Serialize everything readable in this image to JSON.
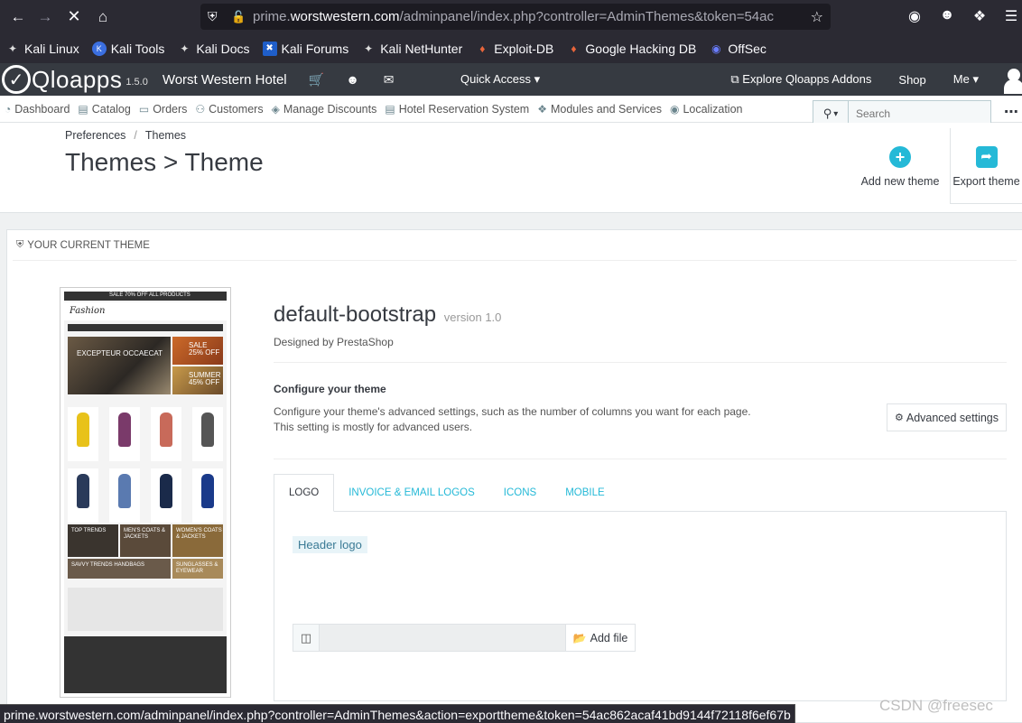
{
  "browser": {
    "url_prefix": "prime.",
    "url_domain": "worstwestern.com",
    "url_path": "/adminpanel/index.php?controller=AdminThemes&token=54ac",
    "bookmarks": [
      "Kali Linux",
      "Kali Tools",
      "Kali Docs",
      "Kali Forums",
      "Kali NetHunter",
      "Exploit-DB",
      "Google Hacking DB",
      "OffSec"
    ],
    "status_url": "prime.worstwestern.com/adminpanel/index.php?controller=AdminThemes&action=exporttheme&token=54ac862acaf41bd9144f72118f6ef67b"
  },
  "header": {
    "logo": "Qloapps",
    "version": "1.5.0",
    "shop_name": "Worst Western Hotel",
    "quick_access": "Quick Access",
    "explore": "Explore Qloapps Addons",
    "shop": "Shop",
    "me": "Me"
  },
  "menu": {
    "items": [
      "Dashboard",
      "Catalog",
      "Orders",
      "Customers",
      "Manage Discounts",
      "Hotel Reservation System",
      "Modules and Services",
      "Localization"
    ],
    "search_placeholder": "Search"
  },
  "page": {
    "breadcrumb_1": "Preferences",
    "breadcrumb_sep": "/",
    "breadcrumb_2": "Themes",
    "title": "Themes > Theme",
    "add_new_theme": "Add new theme",
    "export_theme": "Export theme"
  },
  "panel": {
    "heading": "YOUR CURRENT THEME",
    "theme_name": "default-bootstrap",
    "theme_version": "version 1.0",
    "designed_by": "Designed by PrestaShop",
    "configure_title": "Configure your theme",
    "configure_desc": "Configure your theme's advanced settings, such as the number of columns you want for each page. This setting is mostly for advanced users.",
    "advanced_settings": "Advanced settings",
    "tabs": [
      "LOGO",
      "INVOICE & EMAIL LOGOS",
      "ICONS",
      "MOBILE"
    ],
    "header_logo": "Header logo",
    "add_file": "Add file"
  },
  "preview": {
    "promo": "SALE 70% OFF ALL PRODUCTS",
    "brand": "Fashion",
    "hero_main": "EXCEPTEUR OCCAECAT",
    "hero_sale1": "SALE 25% OFF",
    "hero_sale2": "SUMMER 45% OFF",
    "tile_1": "TOP TRENDS",
    "tile_2": "MEN'S COATS & JACKETS",
    "tile_3": "WOMEN'S COATS & JACKETS",
    "tile_4": "SAVVY TRENDS HANDBAGS",
    "tile_5": "SUNGLASSES & EYEWEAR"
  },
  "watermark": "CSDN @freesec",
  "colors": {
    "accent": "#25b9d7",
    "header_bg": "#363a41",
    "browser_bg": "#2b2a33"
  }
}
